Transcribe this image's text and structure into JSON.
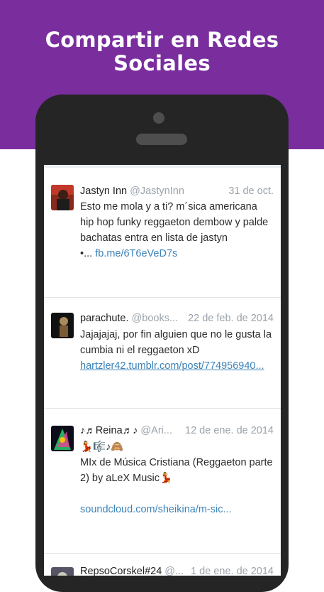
{
  "banner": {
    "title_line1": "Compartir en Redes",
    "title_line2": "Sociales"
  },
  "tweets": [
    {
      "name": "Jastyn Inn",
      "handle": "@JastynInn",
      "date": "31 de oct.",
      "line1": "Esto me mola y a ti? m´sica americana",
      "line2": "hip hop funky reggaeton dembow y palde",
      "line3": "bachatas entra en lista de jastyn",
      "prefix": "•...",
      "link": "fb.me/6T6eVeD7s"
    },
    {
      "name": "parachute.",
      "handle": "@books...",
      "date": "22 de feb. de 2014",
      "line1": "Jajajajaj, por fin alguien que no le gusta la",
      "line2": "cumbia ni el reggaeton xD",
      "link": "hartzler42.tumblr.com/post/774956940..."
    },
    {
      "name": "♪♬Reina♬♪",
      "handle": "@Ari...",
      "date": "12 de ene. de 2014",
      "line1": "💃🎼♪🙈",
      "line2": "MIx de Música Cristiana (Reggaeton parte",
      "line3": "2) by aLeX Music💃",
      "link": "soundcloud.com/sheikina/m-sic..."
    },
    {
      "name": "RepsoCorskel#24",
      "handle": "@...",
      "date": "1 de ene. de 2014"
    }
  ]
}
